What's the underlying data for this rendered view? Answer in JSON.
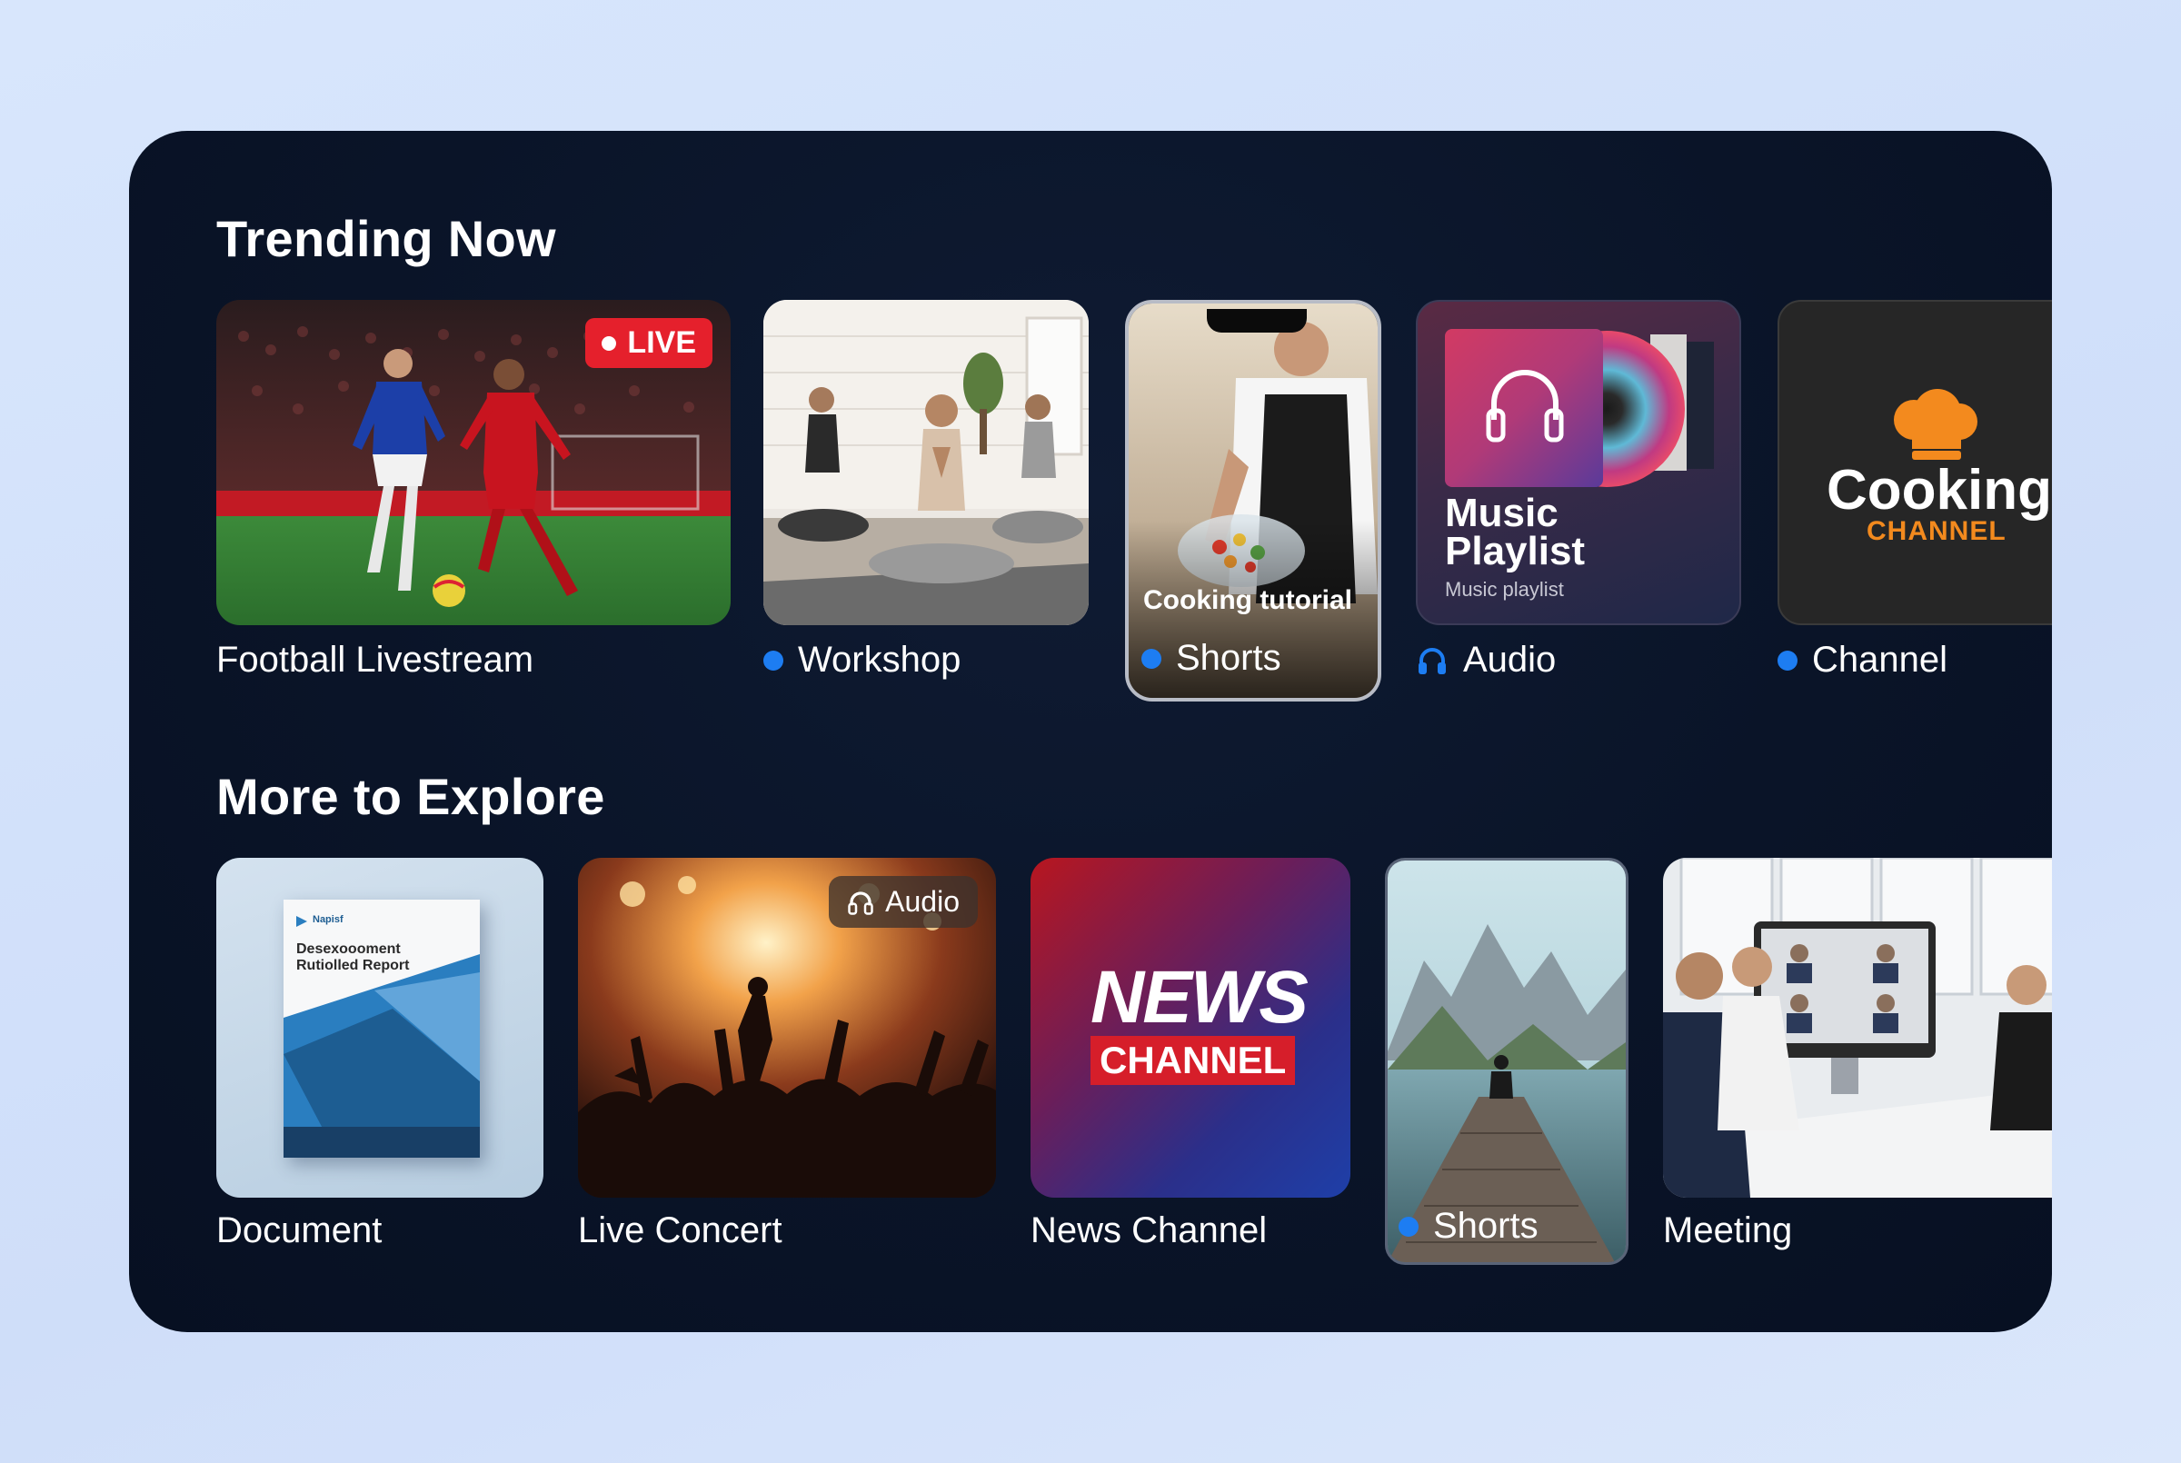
{
  "sections": {
    "trending_title": "Trending Now",
    "explore_title": "More to Explore"
  },
  "trending": {
    "football": {
      "caption": "Football Livestream",
      "badge": "LIVE"
    },
    "workshop": {
      "caption": "Workshop"
    },
    "shorts": {
      "overlay": "Cooking tutorial",
      "caption": "Shorts"
    },
    "music": {
      "title_line1": "Music",
      "title_line2": "Playlist",
      "subtitle": "Music playlist",
      "caption": "Audio"
    },
    "channel": {
      "logo_main": "Cooking",
      "logo_sub": "CHANNEL",
      "caption": "Channel"
    }
  },
  "explore": {
    "document": {
      "brand": "Napisf",
      "title_line1": "Desexoooment",
      "title_line2": "Rutiolled Report",
      "caption": "Document"
    },
    "concert": {
      "badge": "Audio",
      "caption": "Live Concert"
    },
    "news": {
      "logo_main": "NEWS",
      "logo_sub": "CHANNEL",
      "caption": "News Channel"
    },
    "shorts": {
      "caption": "Shorts"
    },
    "meeting": {
      "caption": "Meeting"
    }
  },
  "colors": {
    "panel_bg": "#0a1428",
    "accent_blue": "#1d7df2",
    "live_red": "#e5202c",
    "page_bg": "#d3e2fb"
  }
}
